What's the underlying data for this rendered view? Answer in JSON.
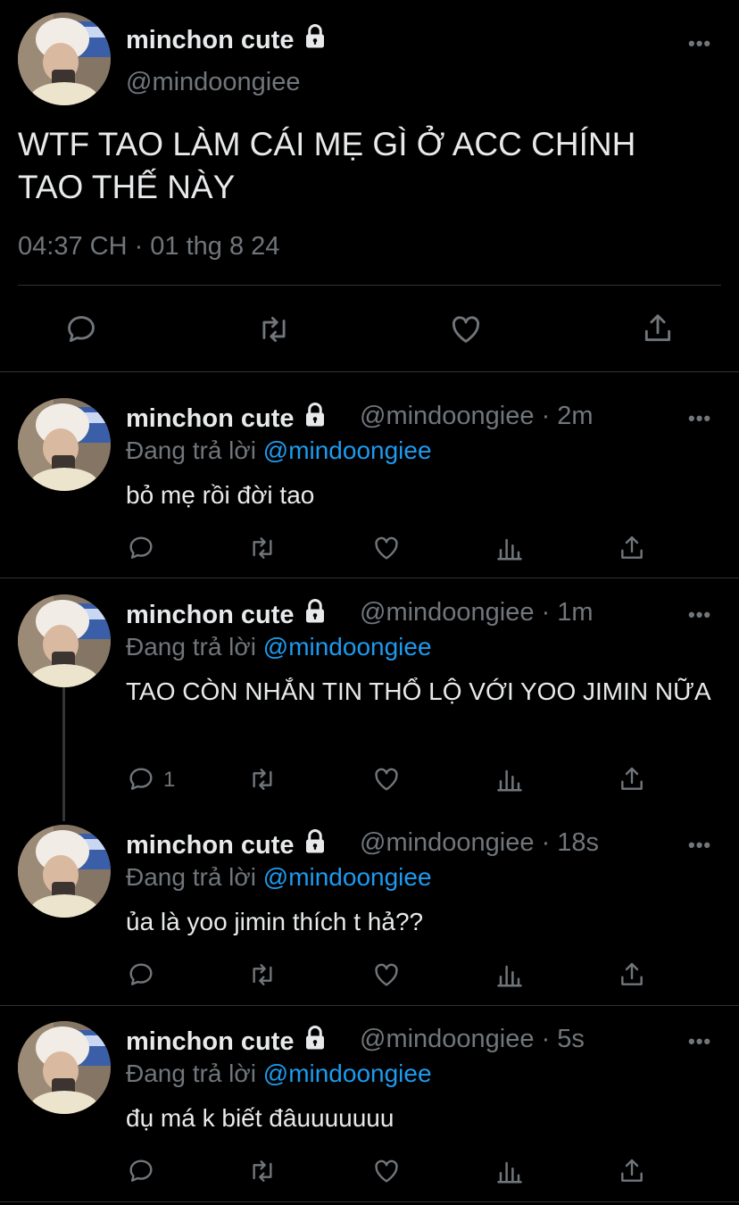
{
  "main_tweet": {
    "display_name": "minchon cute",
    "handle": "@mindoongiee",
    "text_line1": "WTF TAO LÀM CÁI MẸ GÌ Ở ACC CHÍNH",
    "text_line2": "TAO THẾ NÀY",
    "timestamp": "04:37 CH · 01 thg 8 24",
    "more": "•••"
  },
  "replies": [
    {
      "display_name": "minchon cute",
      "handle_time": "@mindoongiee · 2m",
      "replying_label": "Đang trả lời",
      "replying_to": "@mindoongiee",
      "text": "bỏ mẹ rồi đời tao",
      "reply_count": "",
      "more": "•••"
    },
    {
      "display_name": "minchon cute",
      "handle_time": "@mindoongiee · 1m",
      "replying_label": "Đang trả lời",
      "replying_to": "@mindoongiee",
      "text": "TAO CÒN NHẮN TIN THỔ LỘ VỚI YOO JIMIN NỮA",
      "reply_count": "1",
      "more": "•••"
    },
    {
      "display_name": "minchon cute",
      "handle_time": "@mindoongiee · 18s",
      "replying_label": "Đang trả lời",
      "replying_to": "@mindoongiee",
      "text": "ủa là yoo jimin thích t hả??",
      "reply_count": "",
      "more": "•••"
    },
    {
      "display_name": "minchon cute",
      "handle_time": "@mindoongiee · 5s",
      "replying_label": "Đang trả lời",
      "replying_to": "@mindoongiee",
      "text": "đụ má k biết đâuuuuuuu",
      "reply_count": "",
      "more": "•••"
    }
  ],
  "colors": {
    "background": "#000000",
    "text": "#e7e9ea",
    "muted": "#71767b",
    "link": "#1d9bf0",
    "divider": "#2f3336"
  }
}
